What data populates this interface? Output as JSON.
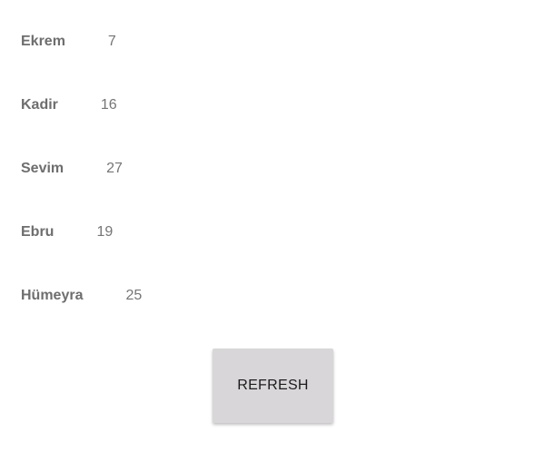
{
  "people": [
    {
      "name": "Ekrem",
      "value": "7"
    },
    {
      "name": "Kadir",
      "value": "16"
    },
    {
      "name": "Sevim",
      "value": "27"
    },
    {
      "name": "Ebru",
      "value": "19"
    },
    {
      "name": "Hümeyra",
      "value": "25"
    }
  ],
  "refresh_button": {
    "label": "REFRESH"
  }
}
